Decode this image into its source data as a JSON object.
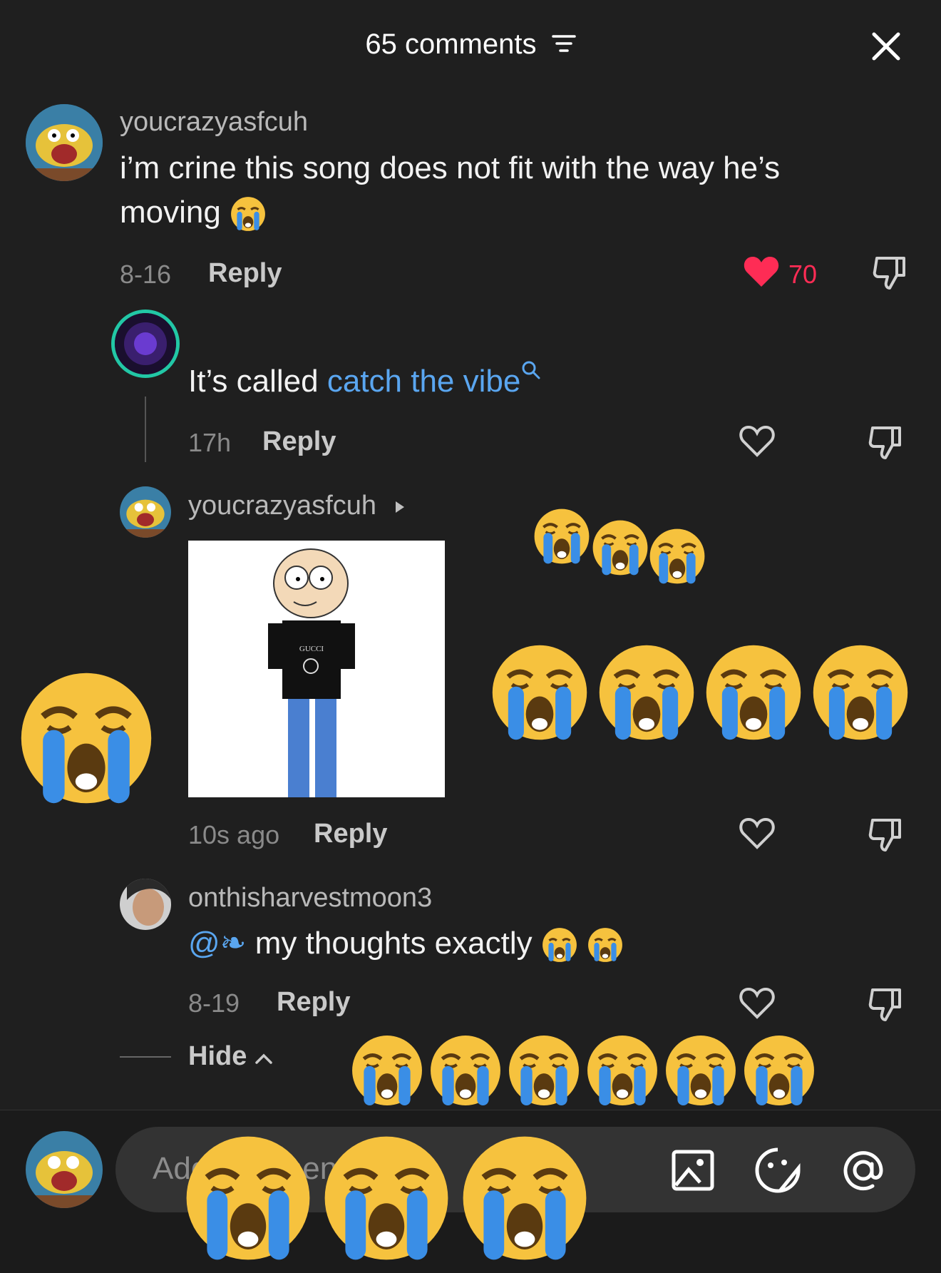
{
  "header": {
    "title": "65 comments",
    "sort_icon": "sort-lines-icon",
    "close_icon": "close-icon"
  },
  "comments": [
    {
      "username": "youcrazyasfcuh",
      "text_line1": "i’m crine this song does not fit with the way he’s",
      "text_line2": "moving",
      "date": "8-16",
      "reply_label": "Reply",
      "likes": "70",
      "liked": true
    },
    {
      "text_prefix": "It’s called ",
      "link_text": "catch the vibe",
      "date": "17h",
      "reply_label": "Reply"
    },
    {
      "username": "youcrazyasfcuh",
      "date": "10s ago",
      "reply_label": "Reply",
      "image_caption": "GUCCI"
    },
    {
      "username": "onthisharvestmoon3",
      "mention": "@❧",
      "text": " my thoughts exactly",
      "date": "8-19",
      "reply_label": "Reply"
    }
  ],
  "hide_label": "Hide",
  "input": {
    "placeholder": "Add comment..."
  },
  "colors": {
    "background": "#1f1f1f",
    "like": "#fe2c55",
    "link": "#5aa6f0"
  }
}
